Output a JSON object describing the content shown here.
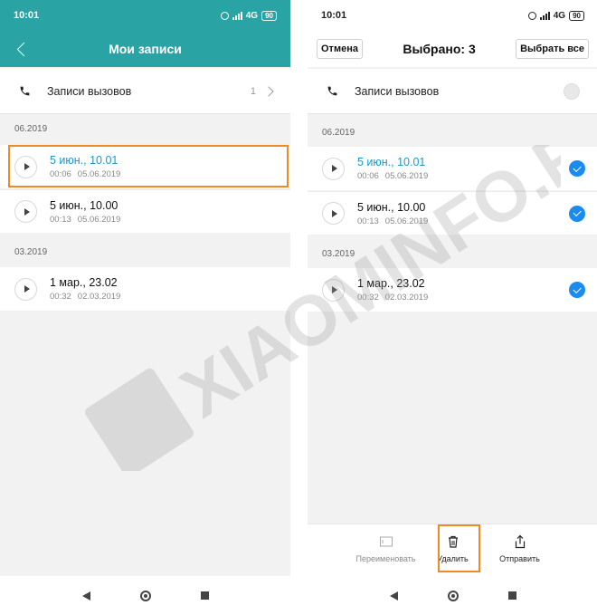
{
  "left": {
    "status": {
      "time": "10:01",
      "network": "4G",
      "battery": "90"
    },
    "title": "Мои записи",
    "calls": {
      "label": "Записи вызовов",
      "count": "1"
    },
    "sections": [
      {
        "date": "06.2019",
        "items": [
          {
            "title": "5 июн., 10.01",
            "duration": "00:06",
            "date": "05.06.2019",
            "active": true
          },
          {
            "title": "5 июн., 10.00",
            "duration": "00:13",
            "date": "05.06.2019",
            "active": false
          }
        ]
      },
      {
        "date": "03.2019",
        "items": [
          {
            "title": "1 мар., 23.02",
            "duration": "00:32",
            "date": "02.03.2019",
            "active": false
          }
        ]
      }
    ]
  },
  "right": {
    "status": {
      "time": "10:01",
      "network": "4G",
      "battery": "90"
    },
    "cancel_label": "Отмена",
    "title": "Выбрано: 3",
    "select_all_label": "Выбрать все",
    "calls": {
      "label": "Записи вызовов"
    },
    "sections": [
      {
        "date": "06.2019",
        "items": [
          {
            "title": "5 июн., 10.01",
            "duration": "00:06",
            "date": "05.06.2019",
            "active": true
          },
          {
            "title": "5 июн., 10.00",
            "duration": "00:13",
            "date": "05.06.2019",
            "active": false
          }
        ]
      },
      {
        "date": "03.2019",
        "items": [
          {
            "title": "1 мар., 23.02",
            "duration": "00:32",
            "date": "02.03.2019",
            "active": false
          }
        ]
      }
    ],
    "actions": {
      "rename": "Переименовать",
      "delete": "Удалить",
      "send": "Отправить"
    }
  },
  "watermark": "XIAOMINFO.RU",
  "colors": {
    "accent_teal": "#2aa3a5",
    "highlight_orange": "#f08a24",
    "check_blue": "#1a8bf0",
    "active_title": "#1b98c9"
  }
}
